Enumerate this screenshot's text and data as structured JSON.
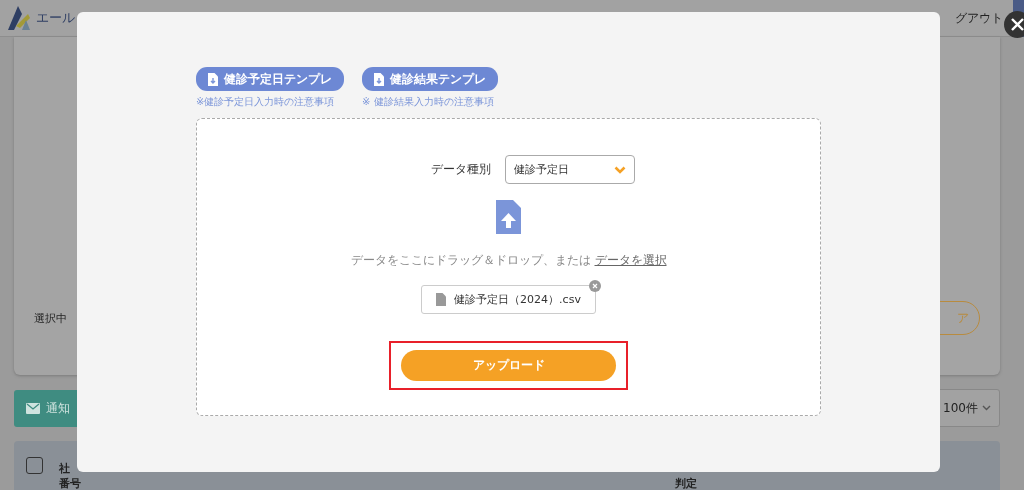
{
  "page": {
    "logo_text": "エール",
    "header_link": "グアウト",
    "selected_label": "選択中",
    "outline_button": "ア",
    "notify_button": "通知",
    "page_size": "100件",
    "select_all_checked": false,
    "table_header": [
      {
        "lines": [
          "社",
          "番号"
        ]
      },
      {
        "lines": [
          "判定"
        ]
      }
    ]
  },
  "modal": {
    "templates": [
      {
        "label": "健診予定日テンプレ",
        "note": "※健診予定日入力時の注意事項"
      },
      {
        "label": "健診結果テンプレ",
        "note": "※ 健診結果入力時の注意事項"
      }
    ],
    "data_type_label": "データ種別",
    "data_type_value": "健診予定日",
    "drop_text": "データをここにドラッグ＆ドロップ、または",
    "select_link": "データを選択",
    "file_name": "健診予定日（2024）.csv",
    "upload_button": "アップロード",
    "upload_highlighted": true
  }
}
